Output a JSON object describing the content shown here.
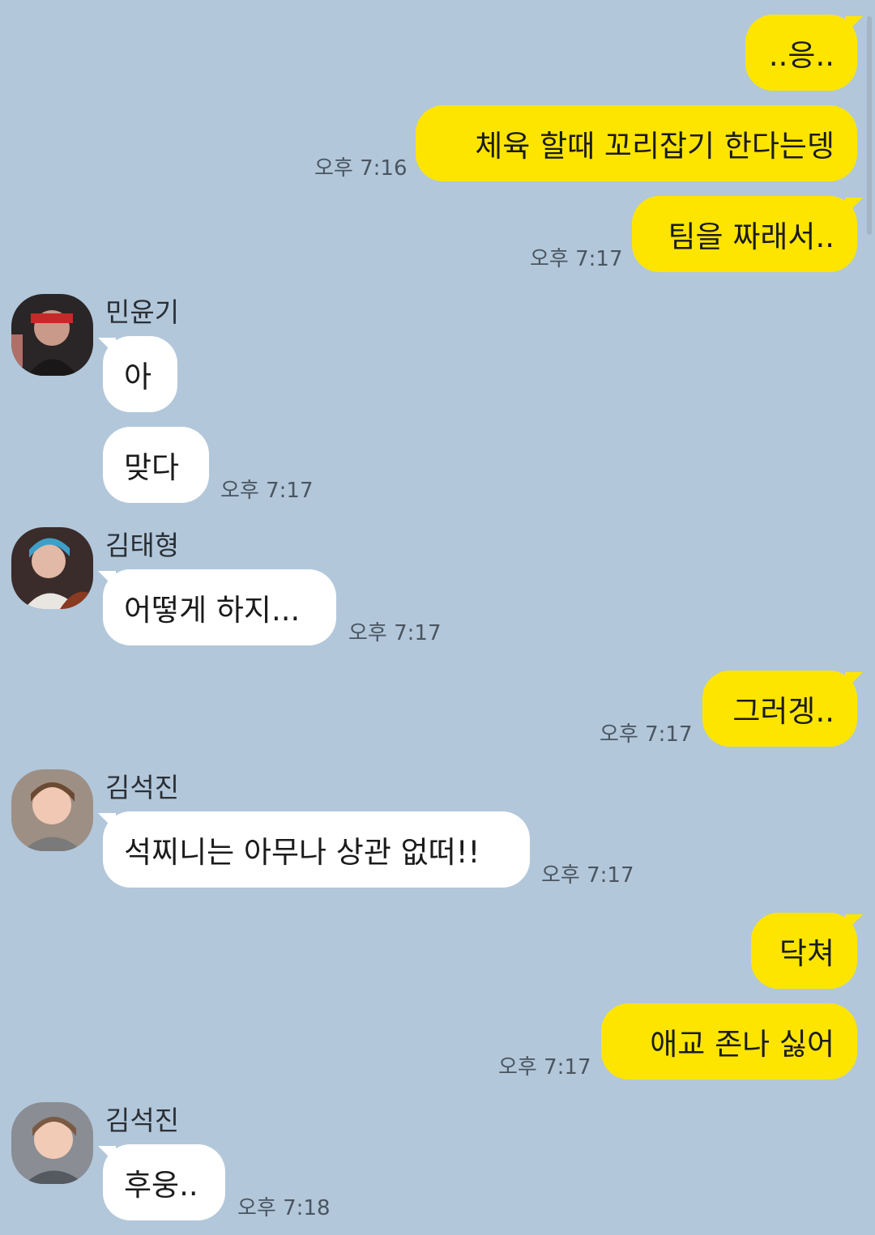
{
  "chat": {
    "time_label": "오후",
    "messages": [
      {
        "text": "..응..",
        "from": "me"
      },
      {
        "text": "체육 할때 꼬리잡기 한다는뎅",
        "from": "me",
        "time": "오후 7:16"
      },
      {
        "text": "팀을 짜래서..",
        "from": "me",
        "time": "오후 7:17"
      },
      {
        "sender": "민윤기",
        "text": "아",
        "from": "other"
      },
      {
        "text": "맞다",
        "from": "other",
        "time": "오후 7:17"
      },
      {
        "sender": "김태형",
        "text": "어떻게 하지...",
        "from": "other",
        "time": "오후 7:17"
      },
      {
        "text": "그러겡..",
        "from": "me",
        "time": "오후 7:17"
      },
      {
        "sender": "김석진",
        "text": "석찌니는 아무나 상관 없떠!!",
        "from": "other",
        "time": "오후 7:17"
      },
      {
        "text": "닥쳐",
        "from": "me"
      },
      {
        "text": "애교 존나 싫어",
        "from": "me",
        "time": "오후 7:17"
      },
      {
        "sender": "김석진",
        "text": "후웅..",
        "from": "other",
        "time": "오후 7:18"
      }
    ]
  },
  "avatars": {
    "yoongi": "avatar-photo-icon",
    "taehyung": "avatar-photo-icon",
    "seokjin": "avatar-photo-icon"
  },
  "colors": {
    "background": "#b2c7da",
    "my_bubble": "#fee500",
    "their_bubble": "#ffffff",
    "timestamp": "#4a5560"
  }
}
